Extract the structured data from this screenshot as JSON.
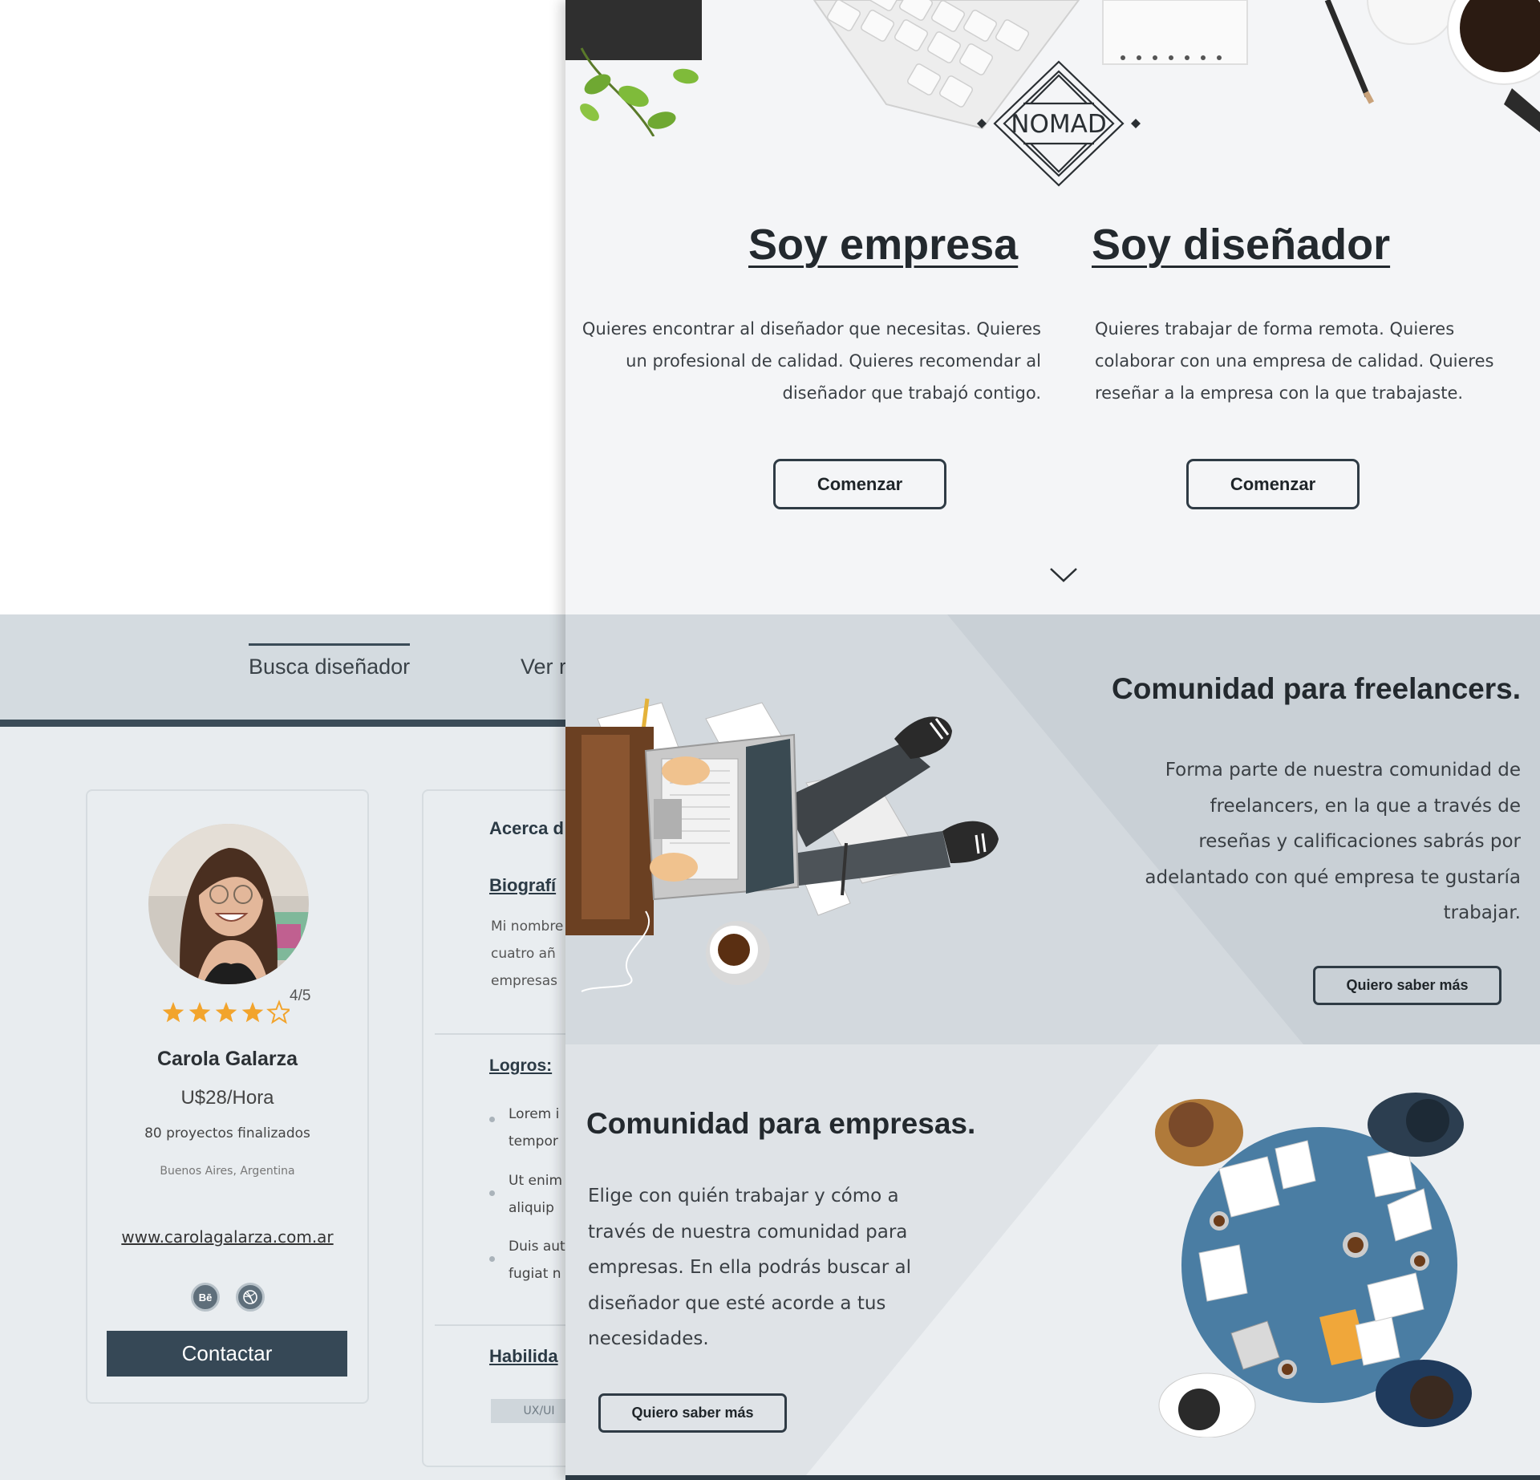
{
  "profile_page": {
    "nav": {
      "tab_active": "Busca diseñador",
      "tab_second": "Ver r"
    },
    "card": {
      "rating": 4,
      "rating_max": 5,
      "rating_text": "4/5",
      "name": "Carola Galarza",
      "rate": "U$28/Hora",
      "projects": "80 proyectos finalizados",
      "location": "Buenos Aires, Argentina",
      "website": "www.carolagalarza.com.ar",
      "social": [
        "Bē",
        "dribbble-icon"
      ],
      "contact_label": "Contactar"
    },
    "about": {
      "heading": "Acerca d",
      "bio_heading": "Biografí",
      "bio_lines": [
        "Mi nombre",
        "cuatro añ",
        "empresas"
      ],
      "achievements_heading": "Logros:",
      "achievements": [
        [
          "Lorem i",
          "tempor"
        ],
        [
          "Ut enim",
          "aliquip"
        ],
        [
          "Duis aut",
          "fugiat n"
        ]
      ],
      "skills_heading": "Habilida",
      "skill_tag": "UX/UI"
    }
  },
  "landing": {
    "logo_text": "NOMAD",
    "empresa": {
      "title": "Soy empresa",
      "description": "Quieres encontrar al diseñador que necesitas. Quieres un profesional de calidad. Quieres recomendar al diseñador que trabajó contigo.",
      "button": "Comenzar"
    },
    "disenador": {
      "title": "Soy diseñador",
      "description": "Quieres trabajar de forma remota. Quieres colaborar con una empresa de calidad. Quieres reseñar a la empresa con la que trabajaste.",
      "button": "Comenzar"
    },
    "freelancers": {
      "title": "Comunidad para freelancers.",
      "description": "Forma parte de nuestra comunidad de freelancers, en la que a través de reseñas y calificaciones sabrás por adelantado con qué empresa te gustaría trabajar.",
      "button": "Quiero saber más"
    },
    "empresas": {
      "title": "Comunidad para empresas.",
      "description": "Elige con quién trabajar y cómo a través de nuestra comunidad para empresas. En ella podrás buscar al diseñador que esté acorde a tus necesidades.",
      "button": "Quiero saber más"
    }
  },
  "colors": {
    "dark_button": "#364856",
    "star": "#f2a42c",
    "nav_bar": "#3b4c58",
    "table_blue": "#4a7da3"
  }
}
